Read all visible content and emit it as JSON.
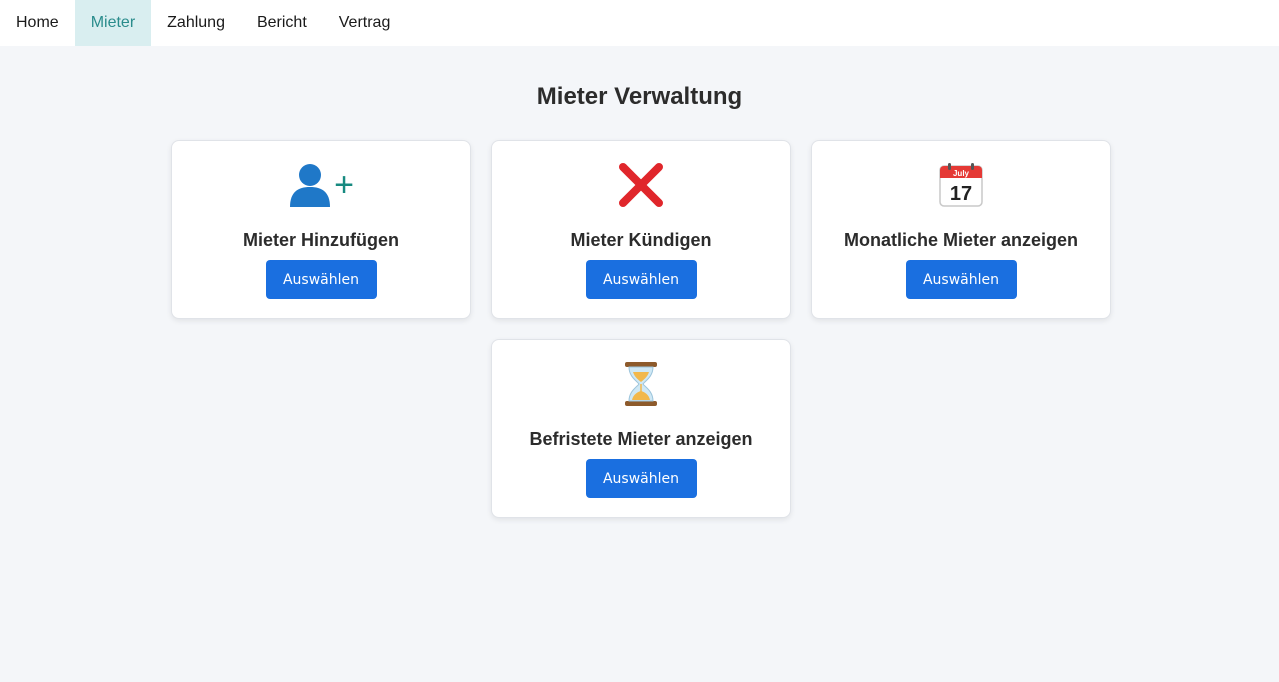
{
  "nav": {
    "items": [
      {
        "label": "Home"
      },
      {
        "label": "Mieter"
      },
      {
        "label": "Zahlung"
      },
      {
        "label": "Bericht"
      },
      {
        "label": "Vertrag"
      }
    ],
    "active": "Mieter"
  },
  "main": {
    "title": "Mieter Verwaltung",
    "cards": [
      {
        "icon": "add-user-icon",
        "label": "Mieter Hinzufügen",
        "button_label": "Auswählen"
      },
      {
        "icon": "cross-icon",
        "label": "Mieter Kündigen",
        "button_label": "Auswählen"
      },
      {
        "icon": "calendar-icon",
        "label": "Monatliche Mieter anzeigen",
        "button_label": "Auswählen",
        "calendar": {
          "month": "July",
          "day": "17"
        }
      },
      {
        "icon": "hourglass-icon",
        "label": "Befristete Mieter anzeigen",
        "button_label": "Auswählen"
      }
    ]
  },
  "colors": {
    "background": "#f4f6f9",
    "button": "#1a6fe0",
    "active_tab_bg": "#d9eef0",
    "active_tab_text": "#2a8c8c"
  }
}
